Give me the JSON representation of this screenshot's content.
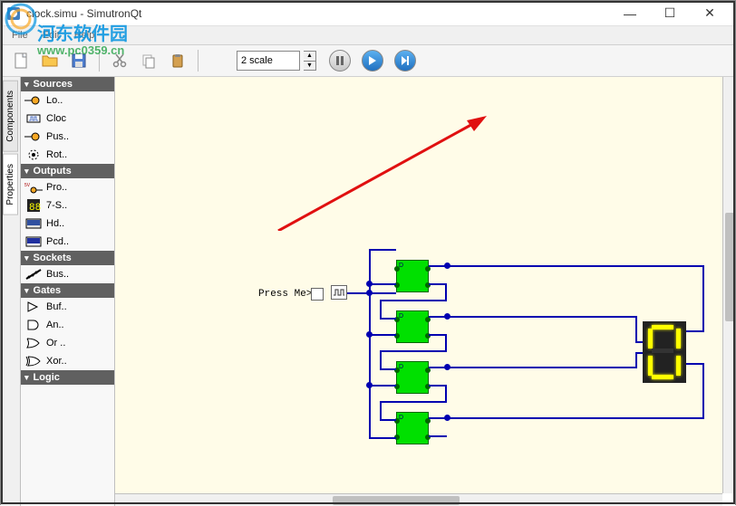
{
  "window": {
    "title": "clock.simu - SimutronQt",
    "minimize": "—",
    "maximize": "☐",
    "close": "✕"
  },
  "menu": {
    "file": "File",
    "edit": "Edit",
    "help": "Help"
  },
  "watermark": {
    "text": "河东软件园",
    "url": "www.pc0359.cn"
  },
  "toolbar": {
    "scale_value": "2 scale",
    "icons": {
      "new": "new-file",
      "open": "open-folder",
      "save": "save",
      "cut": "cut",
      "copy": "copy",
      "paste": "paste",
      "pause": "pause",
      "play": "play",
      "step": "step"
    }
  },
  "tabs": {
    "components": "Components",
    "properties": "Properties"
  },
  "sidebar": {
    "categories": [
      {
        "name": "Sources",
        "items": [
          "Lo..",
          "Cloc",
          "Pus..",
          "Rot.."
        ]
      },
      {
        "name": "Outputs",
        "items": [
          "Pro..",
          "7-S..",
          "Hd..",
          "Pcd.."
        ]
      },
      {
        "name": "Sockets",
        "items": [
          "Bus.."
        ]
      },
      {
        "name": "Gates",
        "items": [
          "Buf..",
          "An..",
          "Or ..",
          "Xor.."
        ]
      },
      {
        "name": "Logic",
        "items": []
      }
    ]
  },
  "schematic": {
    "label": "Press Me>",
    "seven_seg_value": "0"
  }
}
